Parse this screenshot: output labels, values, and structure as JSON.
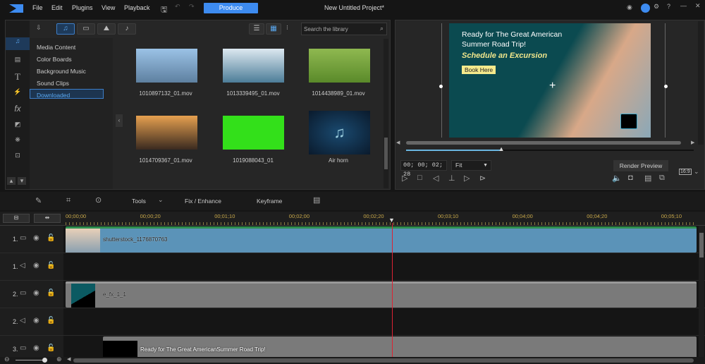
{
  "menubar": {
    "items": [
      "File",
      "Edit",
      "Plugins",
      "View",
      "Playback"
    ],
    "produce": "Produce",
    "project_title": "New Untitled Project*"
  },
  "library": {
    "search_placeholder": "Search the library",
    "categories": [
      "Media Content",
      "Color Boards",
      "Background Music",
      "Sound Clips",
      "Downloaded"
    ],
    "selected_category": "Downloaded",
    "items": [
      {
        "name": "1010897132_01.mov",
        "color": "#8aaed0"
      },
      {
        "name": "1013339495_01.mov",
        "color": "#7fa8c0"
      },
      {
        "name": "1014438989_01.mov",
        "color": "#6e9a3a"
      },
      {
        "name": "1014709367_01.mov",
        "color": "#d08a40"
      },
      {
        "name": "1019088043_01",
        "color": "#33e01a"
      },
      {
        "name": "Air horn",
        "color": "#0e2a45"
      }
    ]
  },
  "preview": {
    "headline": "Ready for The Great American Summer Road Trip!",
    "subhead": "Schedule an Excursion",
    "cta": "Book Here",
    "timecode": "00; 00; 02; 28",
    "zoom": "Fit",
    "render_preview": "Render Preview",
    "aspect": "16:9",
    "progress_fraction": 0.33
  },
  "toolbar": {
    "tools": "Tools",
    "fix": "Fix / Enhance",
    "keyframe": "Keyframe"
  },
  "timeline": {
    "ruler": [
      "00;00;00",
      "00;00;20",
      "00;01;10",
      "00;02;00",
      "00;02;20",
      "00;03;10",
      "00;04;00",
      "00;04;20",
      "00;05;10"
    ],
    "tracks": [
      {
        "label": "1.",
        "type": "video",
        "clip": "shutterstock_1176870763"
      },
      {
        "label": "1.",
        "type": "audio",
        "clip": ""
      },
      {
        "label": "2.",
        "type": "video",
        "clip": "e_fx_1_1"
      },
      {
        "label": "2.",
        "type": "audio",
        "clip": ""
      },
      {
        "label": "3.",
        "type": "video",
        "clip": "Ready for The Great AmericanSummer Road Trip!"
      }
    ]
  }
}
